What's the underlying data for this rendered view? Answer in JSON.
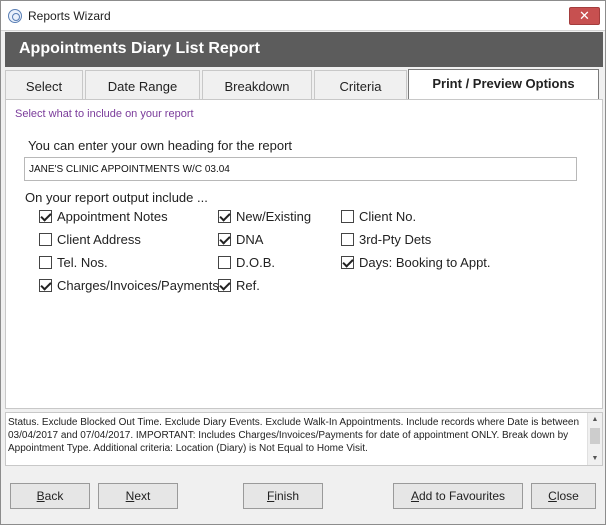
{
  "window": {
    "title": "Reports Wizard",
    "close_glyph": "✕",
    "icon": "app-icon"
  },
  "banner": {
    "title": "Appointments Diary List Report"
  },
  "tabs": [
    {
      "label": "Select",
      "active": false
    },
    {
      "label": "Date Range",
      "active": false
    },
    {
      "label": "Breakdown",
      "active": false
    },
    {
      "label": "Criteria",
      "active": false
    },
    {
      "label": "Print / Preview Options",
      "active": true
    }
  ],
  "panel": {
    "hint": "Select what to include on your report",
    "heading_label": "You can enter your own heading for the report",
    "heading_value": "JANE'S CLINIC APPOINTMENTS W/C 03.04",
    "include_label": "On your report output include ...",
    "options": [
      {
        "label": "Appointment Notes",
        "checked": true
      },
      {
        "label": "New/Existing",
        "checked": true
      },
      {
        "label": "Client No.",
        "checked": false
      },
      {
        "label": "Client Address",
        "checked": false
      },
      {
        "label": "DNA",
        "checked": true
      },
      {
        "label": "3rd-Pty Dets",
        "checked": false
      },
      {
        "label": "Tel. Nos.",
        "checked": false
      },
      {
        "label": "D.O.B.",
        "checked": false
      },
      {
        "label": "Days: Booking to Appt.",
        "checked": true
      },
      {
        "label": "Charges/Invoices/Payments",
        "checked": true
      },
      {
        "label": "Ref.",
        "checked": true
      }
    ]
  },
  "status": {
    "text": "Status. Exclude Blocked Out Time. Exclude Diary Events. Exclude Walk-In Appointments. Include records where Date is between 03/04/2017 and 07/04/2017. IMPORTANT: Includes Charges/Invoices/Payments for date of appointment ONLY. Break down by Appointment Type. Additional criteria: Location (Diary) is Not Equal to Home Visit."
  },
  "buttons": {
    "back": {
      "mnemonic": "B",
      "rest": "ack"
    },
    "next": {
      "mnemonic": "N",
      "rest": "ext"
    },
    "finish": {
      "mnemonic": "F",
      "rest": "inish"
    },
    "favourites": {
      "mnemonic": "A",
      "rest": "dd to Favourites"
    },
    "close": {
      "mnemonic": "C",
      "rest": "lose"
    }
  },
  "colors": {
    "banner": "#5c5c5c",
    "close_button": "#c75050",
    "hint_text": "#7a3b9a"
  }
}
